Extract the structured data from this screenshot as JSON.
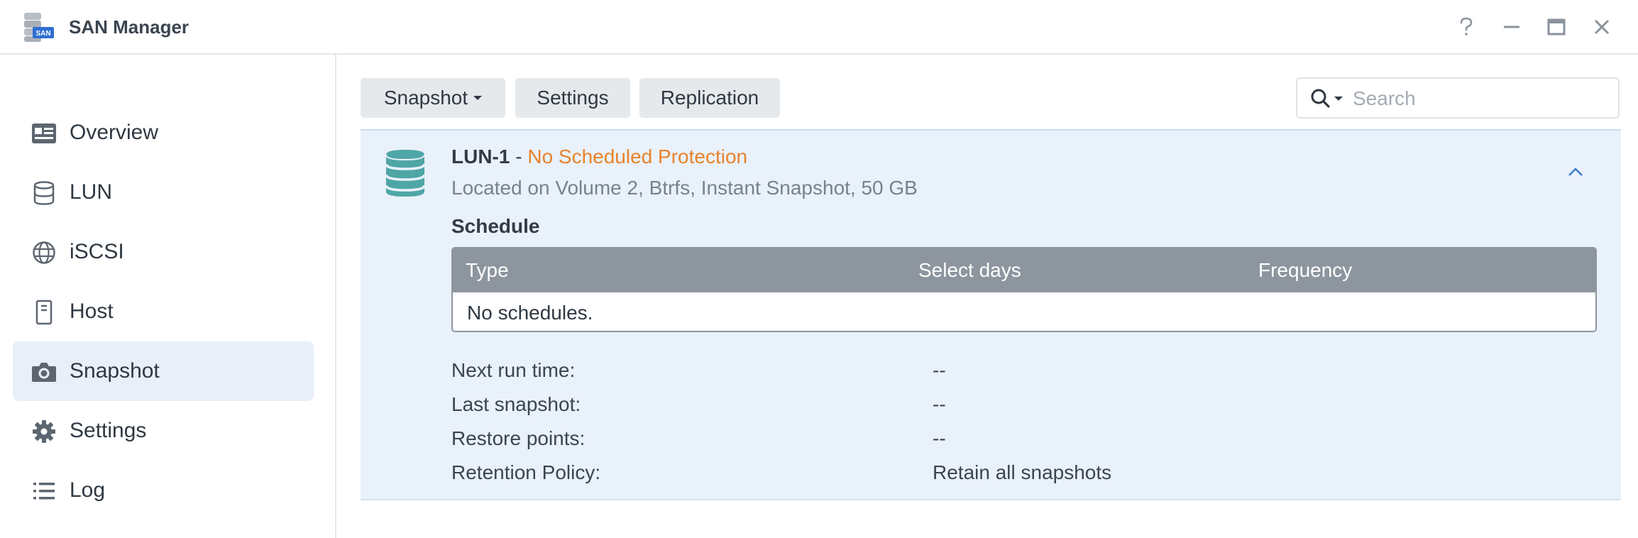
{
  "app": {
    "title": "SAN Manager",
    "icon": "san-manager-icon",
    "icon_badge": "SAN"
  },
  "window_controls": [
    {
      "name": "help",
      "icon": "help-icon"
    },
    {
      "name": "minimize",
      "icon": "minimize-icon"
    },
    {
      "name": "maximize",
      "icon": "maximize-icon"
    },
    {
      "name": "close",
      "icon": "close-icon"
    }
  ],
  "sidebar": {
    "items": [
      {
        "label": "Overview",
        "icon": "overview-icon",
        "active": false
      },
      {
        "label": "LUN",
        "icon": "database-icon",
        "active": false
      },
      {
        "label": "iSCSI",
        "icon": "globe-icon",
        "active": false
      },
      {
        "label": "Host",
        "icon": "host-icon",
        "active": false
      },
      {
        "label": "Snapshot",
        "icon": "camera-icon",
        "active": true
      },
      {
        "label": "Settings",
        "icon": "gear-icon",
        "active": false
      },
      {
        "label": "Log",
        "icon": "list-icon",
        "active": false
      }
    ]
  },
  "toolbar": {
    "snapshot_label": "Snapshot",
    "settings_label": "Settings",
    "replication_label": "Replication",
    "search_placeholder": "Search"
  },
  "lun": {
    "name": "LUN-1",
    "separator": " - ",
    "status": "No Scheduled Protection",
    "details": "Located on Volume 2, Btrfs, Instant Snapshot, 50 GB",
    "schedule_title": "Schedule",
    "table": {
      "headers": [
        "Type",
        "Select days",
        "Frequency"
      ],
      "empty_text": "No schedules."
    },
    "info": [
      {
        "label": "Next run time:",
        "value": "--"
      },
      {
        "label": "Last snapshot:",
        "value": "--"
      },
      {
        "label": "Restore points:",
        "value": "--"
      },
      {
        "label": "Retention Policy:",
        "value": "Retain all snapshots"
      }
    ]
  },
  "colors": {
    "accent": "#3b7bd1",
    "status_warning": "#e9822a",
    "lun_icon": "#4fa6a6",
    "panel_bg": "#e9f1fb",
    "active_nav_bg": "#e8eff9",
    "table_header_bg": "#8d959e"
  }
}
